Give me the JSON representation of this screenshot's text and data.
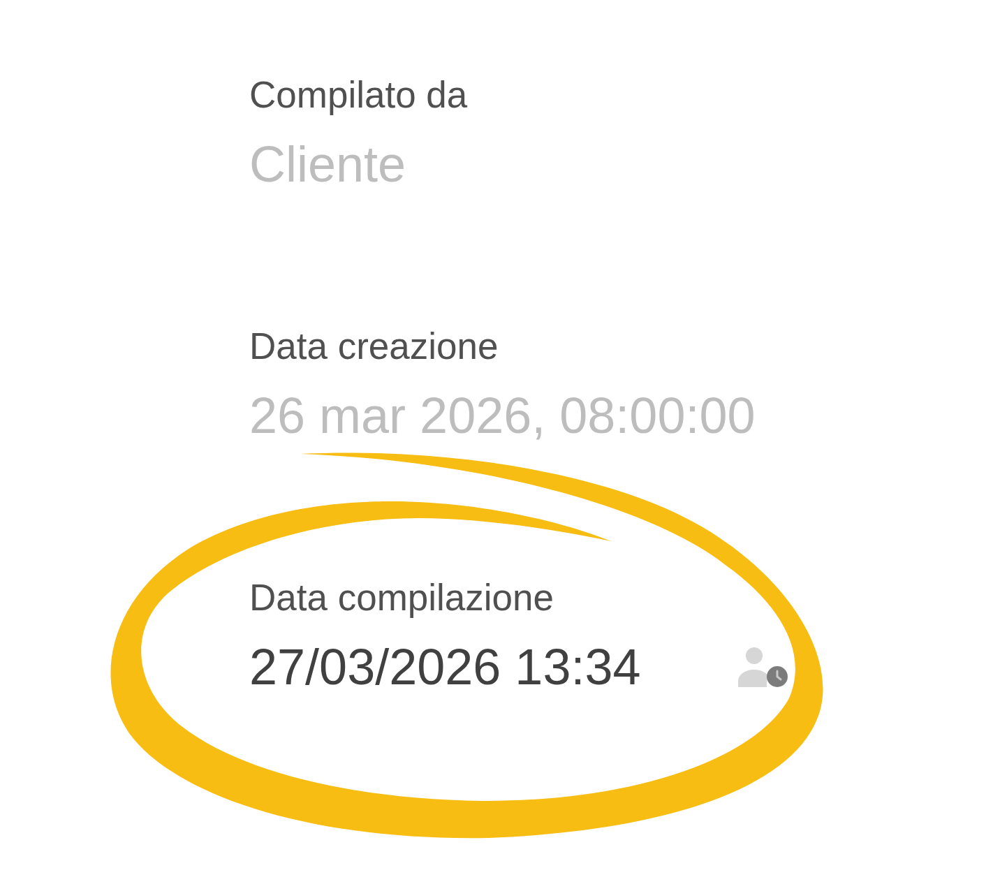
{
  "fields": [
    {
      "label": "Compilato da",
      "value": "Cliente",
      "disabled": true,
      "kind": "plain"
    },
    {
      "label": "Data creazione",
      "value": "26 mar 2026, 08:00:00",
      "disabled": true,
      "kind": "plain"
    },
    {
      "label": "Data compilazione",
      "value": "27/03/2026 13:34",
      "disabled": false,
      "kind": "user_timestamp"
    }
  ]
}
